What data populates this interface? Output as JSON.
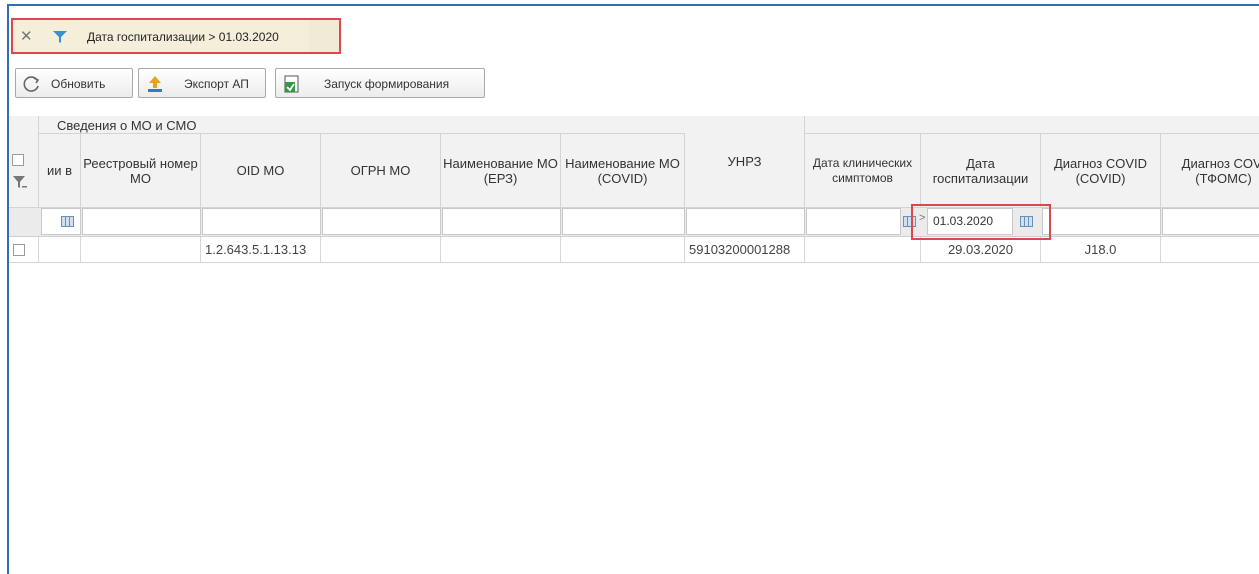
{
  "filter": {
    "close": "✕",
    "text": "Дата госпитализации > 01.03.2020"
  },
  "toolbar": {
    "refresh_label": "Обновить",
    "export_label": "Экспорт АП",
    "run_label": "Запуск формирования"
  },
  "grid": {
    "group_label": "Сведения о МО и СМО",
    "columns": [
      "ии в",
      "Реестровый номер МО",
      "OID МО",
      "ОГРН МО",
      "Наименование МО (ЕРЗ)",
      "Наименование МО (COVID)",
      "УНРЗ",
      "Дата клинических симптомов",
      "Дата госпитализации",
      "Диагноз COVID (COVID)",
      "Диагноз COVI (ТФОМС)"
    ],
    "filter_operator": ">",
    "filter_value": "01.03.2020",
    "rows": [
      {
        "oid": "1.2.643.5.1.13.13",
        "unrz": "59103200001288",
        "hosp_date": "29.03.2020",
        "diagnosis": "J18.0"
      }
    ]
  },
  "colors": {
    "border_accent": "#2f6fb5",
    "highlight": "#e0474c"
  }
}
